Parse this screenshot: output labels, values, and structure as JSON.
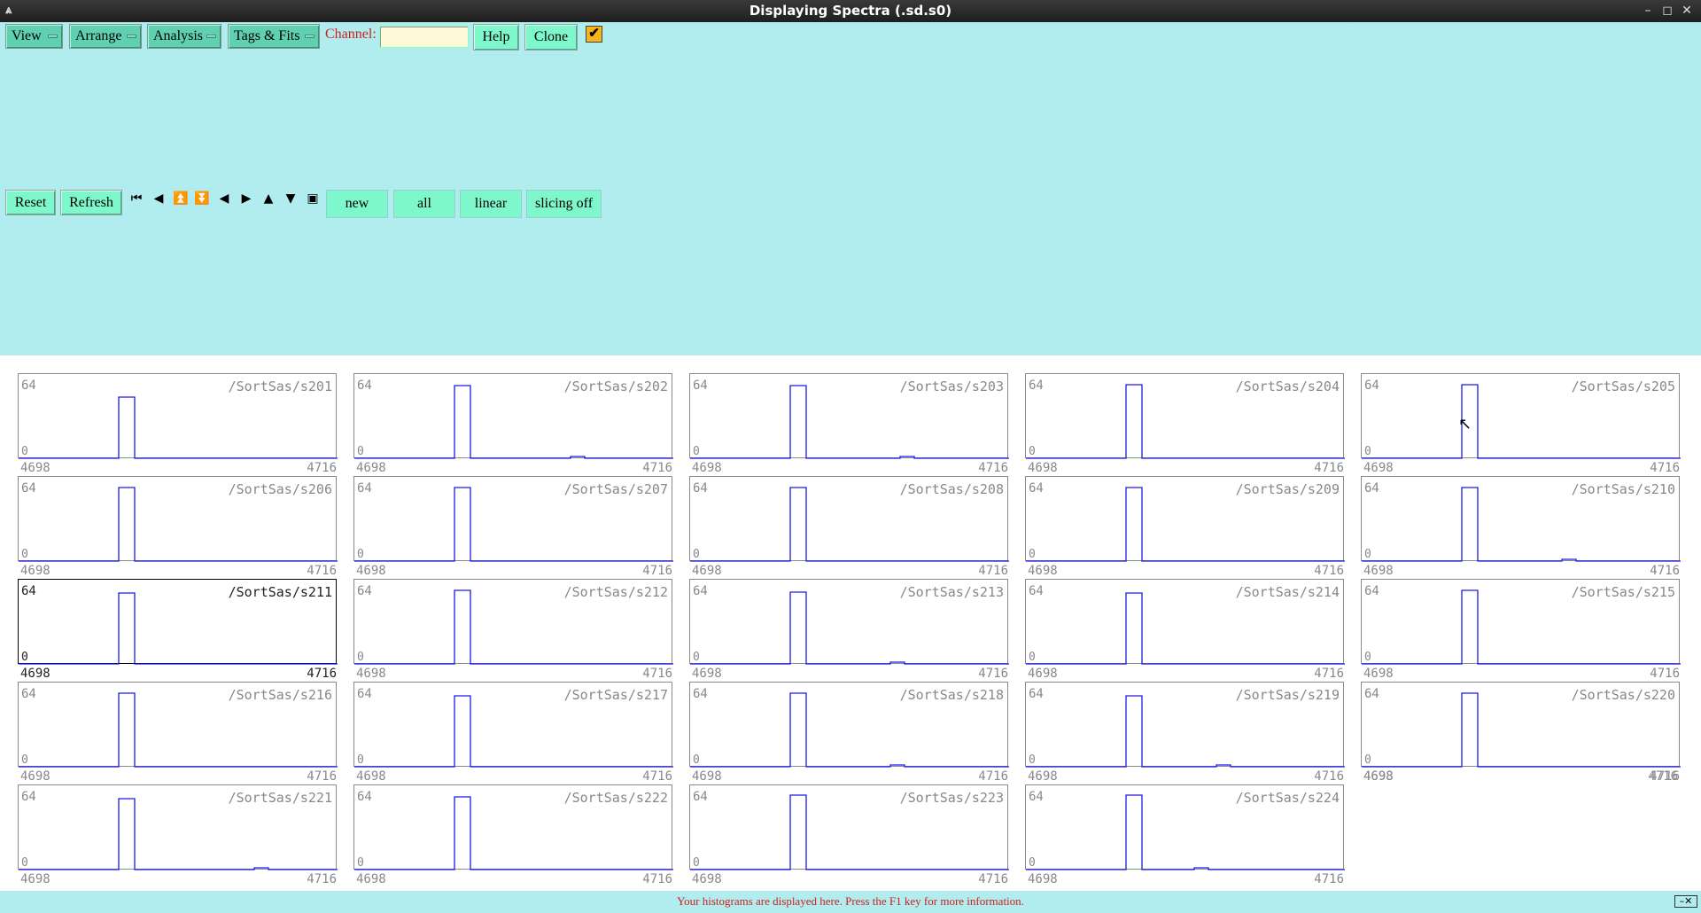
{
  "window": {
    "title": "Displaying Spectra (.sd.s0)",
    "app_icon": "spectrum-icon",
    "controls": [
      "minimize-icon",
      "maximize-icon",
      "close-icon"
    ]
  },
  "menus": [
    {
      "label": "View"
    },
    {
      "label": "Arrange"
    },
    {
      "label": "Analysis"
    },
    {
      "label": "Tags & Fits"
    }
  ],
  "channel": {
    "label": "Channel:",
    "value": ""
  },
  "buttons": {
    "help": "Help",
    "clone": "Clone",
    "reset": "Reset",
    "refresh": "Refresh"
  },
  "checkbox": {
    "checked": true,
    "glyph": "✔"
  },
  "nav_icons": [
    "first-icon",
    "expand-horizontal-icon",
    "page-up-icon",
    "page-down-icon",
    "previous-icon",
    "next-icon",
    "scroll-up-icon",
    "scroll-down-icon",
    "stop-icon"
  ],
  "toggles": {
    "new": "new",
    "all": "all",
    "scale": "linear",
    "slicing": "slicing off"
  },
  "colors": {
    "panel_bg": "#b1ecee",
    "histogram_line": "#1a1ae6",
    "status_text": "#d21e1e",
    "checkbox": "#f5b31c"
  },
  "spectra": [
    {
      "name": "/SortSas/s201",
      "ymax": "64",
      "ymin": "0",
      "xmin": "4698",
      "xmax": "4716",
      "peak": 0.8,
      "bump": null
    },
    {
      "name": "/SortSas/s202",
      "ymax": "64",
      "ymin": "0",
      "xmin": "4698",
      "xmax": "4716",
      "peak": 0.95,
      "bump": 0.7
    },
    {
      "name": "/SortSas/s203",
      "ymax": "64",
      "ymin": "0",
      "xmin": "4698",
      "xmax": "4716",
      "peak": 0.95,
      "bump": 0.68
    },
    {
      "name": "/SortSas/s204",
      "ymax": "64",
      "ymin": "0",
      "xmin": "4698",
      "xmax": "4716",
      "peak": 0.97,
      "bump": null
    },
    {
      "name": "/SortSas/s205",
      "ymax": "64",
      "ymin": "0",
      "xmin": "4698",
      "xmax": "4716",
      "peak": 0.97,
      "bump": null
    },
    {
      "name": "/SortSas/s206",
      "ymax": "64",
      "ymin": "0",
      "xmin": "4698",
      "xmax": "4716",
      "peak": 0.97,
      "bump": null
    },
    {
      "name": "/SortSas/s207",
      "ymax": "64",
      "ymin": "0",
      "xmin": "4698",
      "xmax": "4716",
      "peak": 0.97,
      "bump": null
    },
    {
      "name": "/SortSas/s208",
      "ymax": "64",
      "ymin": "0",
      "xmin": "4698",
      "xmax": "4716",
      "peak": 0.97,
      "bump": null
    },
    {
      "name": "/SortSas/s209",
      "ymax": "64",
      "ymin": "0",
      "xmin": "4698",
      "xmax": "4716",
      "peak": 0.97,
      "bump": null
    },
    {
      "name": "/SortSas/s210",
      "ymax": "64",
      "ymin": "0",
      "xmin": "4698",
      "xmax": "4716",
      "peak": 0.97,
      "bump": 0.65
    },
    {
      "name": "/SortSas/s211",
      "ymax": "64",
      "ymin": "0",
      "xmin": "4698",
      "xmax": "4716",
      "peak": 0.93,
      "bump": null,
      "selected": true
    },
    {
      "name": "/SortSas/s212",
      "ymax": "64",
      "ymin": "0",
      "xmin": "4698",
      "xmax": "4716",
      "peak": 0.96,
      "bump": null
    },
    {
      "name": "/SortSas/s213",
      "ymax": "64",
      "ymin": "0",
      "xmin": "4698",
      "xmax": "4716",
      "peak": 0.94,
      "bump": 0.65
    },
    {
      "name": "/SortSas/s214",
      "ymax": "64",
      "ymin": "0",
      "xmin": "4698",
      "xmax": "4716",
      "peak": 0.93,
      "bump": null
    },
    {
      "name": "/SortSas/s215",
      "ymax": "64",
      "ymin": "0",
      "xmin": "4698",
      "xmax": "4716",
      "peak": 0.96,
      "bump": null
    },
    {
      "name": "/SortSas/s216",
      "ymax": "64",
      "ymin": "0",
      "xmin": "4698",
      "xmax": "4716",
      "peak": 0.96,
      "bump": null
    },
    {
      "name": "/SortSas/s217",
      "ymax": "64",
      "ymin": "0",
      "xmin": "4698",
      "xmax": "4716",
      "peak": 0.93,
      "bump": null
    },
    {
      "name": "/SortSas/s218",
      "ymax": "64",
      "ymin": "0",
      "xmin": "4698",
      "xmax": "4716",
      "peak": 0.96,
      "bump": 0.65
    },
    {
      "name": "/SortSas/s219",
      "ymax": "64",
      "ymin": "0",
      "xmin": "4698",
      "xmax": "4716",
      "peak": 0.93,
      "bump": 0.62
    },
    {
      "name": "/SortSas/s220",
      "ymax": "64",
      "ymin": "0",
      "xmin": "4698",
      "xmax": "4716",
      "peak": 0.96,
      "bump": null
    },
    {
      "name": "/SortSas/s221",
      "ymax": "64",
      "ymin": "0",
      "xmin": "4698",
      "xmax": "4716",
      "peak": 0.93,
      "bump": 0.76
    },
    {
      "name": "/SortSas/s222",
      "ymax": "64",
      "ymin": "0",
      "xmin": "4698",
      "xmax": "4716",
      "peak": 0.95,
      "bump": null
    },
    {
      "name": "/SortSas/s223",
      "ymax": "64",
      "ymin": "0",
      "xmin": "4698",
      "xmax": "4716",
      "peak": 0.98,
      "bump": null
    },
    {
      "name": "/SortSas/s224",
      "ymax": "64",
      "ymin": "0",
      "xmin": "4698",
      "xmax": "4716",
      "peak": 0.98,
      "bump": 0.55
    }
  ],
  "empty_axis": {
    "xmin": "4698",
    "xmax": "4716"
  },
  "status": {
    "text": "Your histograms are displayed here. Press the F1 key for more information."
  }
}
